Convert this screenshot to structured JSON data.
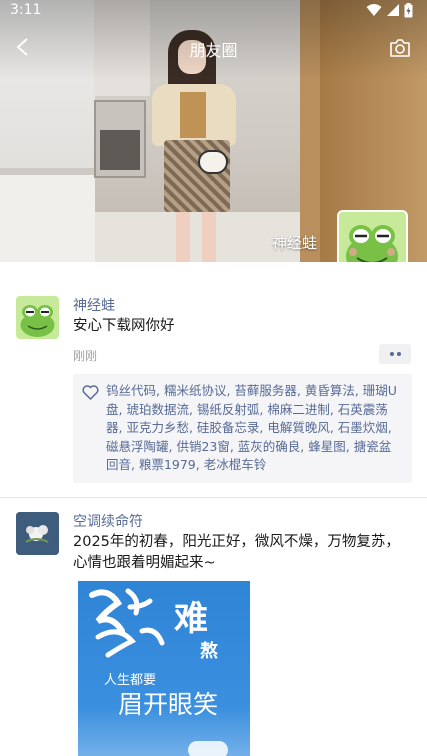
{
  "status_bar": {
    "time": "3:11"
  },
  "topbar": {
    "title": "朋友圈"
  },
  "profile": {
    "name": "神经蛙"
  },
  "posts": [
    {
      "author": "神经蛙",
      "text": "安心下载网你好",
      "time": "刚刚",
      "likes": "钨丝代码, 糯米纸协议, 苔藓服务器, 黄昏算法, 珊瑚U盘, 琥珀数据流, 锡纸反射弧, 棉麻二进制, 石英震荡器, 亚克力乡愁, 硅胶备忘录, 电解質晚风, 石墨炊烟, 磁悬浮陶罐, 供销23窗, 蓝灰的确良, 蜂星图, 搪瓷盆回音, 粮票1979, 老冰棍车铃"
    },
    {
      "author": "空调续命符",
      "text": "2025年的初春，阳光正好，微风不燥，万物复苏，心情也跟着明媚起来~",
      "image_text": {
        "line1": "难",
        "line2": "熬",
        "line3": "人生都要",
        "line4": "眉开眼笑"
      }
    }
  ],
  "colors": {
    "link": "#576b95",
    "likes_bg": "#f5f5f7",
    "poster_bg": "#2f84d6"
  }
}
